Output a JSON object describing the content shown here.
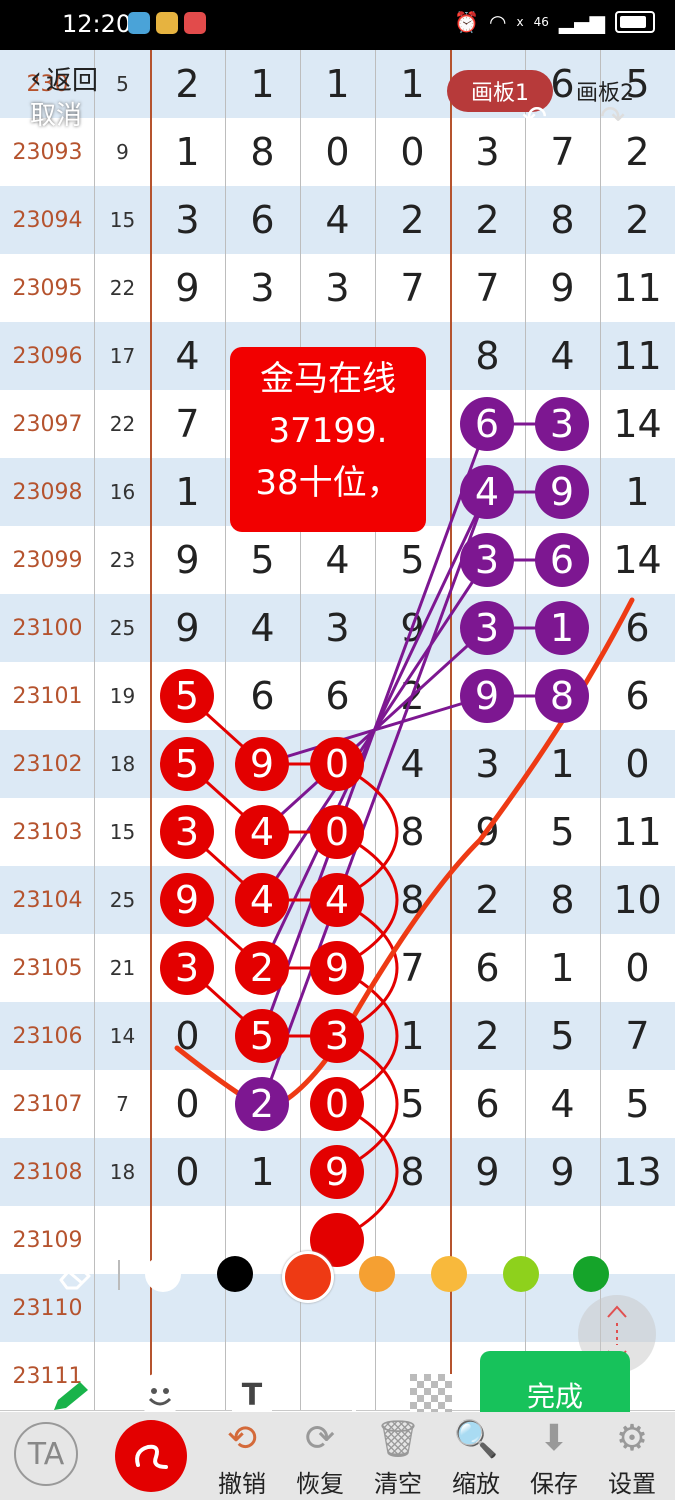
{
  "status": {
    "time": "12:20",
    "network": "46",
    "wifi_badge": "x"
  },
  "nav": {
    "back_label": "返回",
    "cancel_label": "取消",
    "board1_label": "画板1",
    "board2_label": "画板2"
  },
  "rows": [
    {
      "issue": "230",
      "sum": "5",
      "digits": [
        "2",
        "1",
        "1",
        "1",
        "",
        "6",
        "5"
      ]
    },
    {
      "issue": "23093",
      "sum": "9",
      "digits": [
        "1",
        "8",
        "0",
        "0",
        "3",
        "7",
        "2"
      ]
    },
    {
      "issue": "23094",
      "sum": "15",
      "digits": [
        "3",
        "6",
        "4",
        "2",
        "2",
        "8",
        "2"
      ]
    },
    {
      "issue": "23095",
      "sum": "22",
      "digits": [
        "9",
        "3",
        "3",
        "7",
        "7",
        "9",
        "11"
      ]
    },
    {
      "issue": "23096",
      "sum": "17",
      "digits": [
        "4",
        "",
        "",
        "",
        "8",
        "4",
        "11"
      ]
    },
    {
      "issue": "23097",
      "sum": "22",
      "digits": [
        "7",
        "",
        "",
        "",
        "",
        "",
        "14"
      ]
    },
    {
      "issue": "23098",
      "sum": "16",
      "digits": [
        "1",
        "",
        "",
        "",
        "",
        "",
        "1"
      ]
    },
    {
      "issue": "23099",
      "sum": "23",
      "digits": [
        "9",
        "5",
        "4",
        "5",
        "",
        "",
        "14"
      ]
    },
    {
      "issue": "23100",
      "sum": "25",
      "digits": [
        "9",
        "4",
        "3",
        "9",
        "",
        "",
        "6"
      ]
    },
    {
      "issue": "23101",
      "sum": "19",
      "digits": [
        "",
        "6",
        "6",
        "2",
        "",
        "",
        "6"
      ]
    },
    {
      "issue": "23102",
      "sum": "18",
      "digits": [
        "",
        "",
        "",
        "4",
        "3",
        "1",
        "0"
      ]
    },
    {
      "issue": "23103",
      "sum": "15",
      "digits": [
        "",
        "",
        "",
        "8",
        "9",
        "5",
        "11"
      ]
    },
    {
      "issue": "23104",
      "sum": "25",
      "digits": [
        "",
        "",
        "",
        "8",
        "2",
        "8",
        "10"
      ]
    },
    {
      "issue": "23105",
      "sum": "21",
      "digits": [
        "",
        "",
        "",
        "7",
        "6",
        "1",
        "0"
      ]
    },
    {
      "issue": "23106",
      "sum": "14",
      "digits": [
        "0",
        "",
        "",
        "1",
        "2",
        "5",
        "7"
      ]
    },
    {
      "issue": "23107",
      "sum": "7",
      "digits": [
        "0",
        "",
        "",
        "5",
        "6",
        "4",
        "5"
      ]
    },
    {
      "issue": "23108",
      "sum": "18",
      "digits": [
        "0",
        "1",
        "",
        "8",
        "9",
        "9",
        "13"
      ]
    },
    {
      "issue": "23109",
      "sum": "",
      "digits": [
        "",
        "",
        "",
        "",
        "",
        "",
        ""
      ]
    },
    {
      "issue": "23110",
      "sum": "",
      "digits": [
        "",
        "",
        "",
        "",
        "",
        "",
        ""
      ]
    },
    {
      "issue": "23111",
      "sum": "",
      "digits": [
        "",
        "",
        "",
        "",
        "",
        "",
        ""
      ]
    }
  ],
  "note": {
    "line1": "金马在线",
    "line2": "37199.",
    "line3": "38十位，"
  },
  "red_circles": [
    {
      "row": 9,
      "col": 0,
      "n": "5"
    },
    {
      "row": 10,
      "col": 0,
      "n": "5"
    },
    {
      "row": 10,
      "col": 1,
      "n": "9"
    },
    {
      "row": 10,
      "col": 2,
      "n": "0"
    },
    {
      "row": 11,
      "col": 0,
      "n": "3"
    },
    {
      "row": 11,
      "col": 1,
      "n": "4"
    },
    {
      "row": 11,
      "col": 2,
      "n": "0"
    },
    {
      "row": 12,
      "col": 0,
      "n": "9"
    },
    {
      "row": 12,
      "col": 1,
      "n": "4"
    },
    {
      "row": 12,
      "col": 2,
      "n": "4"
    },
    {
      "row": 13,
      "col": 0,
      "n": "3"
    },
    {
      "row": 13,
      "col": 1,
      "n": "2"
    },
    {
      "row": 13,
      "col": 2,
      "n": "9"
    },
    {
      "row": 14,
      "col": 1,
      "n": "5"
    },
    {
      "row": 14,
      "col": 2,
      "n": "3"
    },
    {
      "row": 15,
      "col": 2,
      "n": "0"
    },
    {
      "row": 16,
      "col": 2,
      "n": "9"
    },
    {
      "row": 17,
      "col": 2,
      "n": ""
    }
  ],
  "purple_circles": [
    {
      "row": 5,
      "col": 4,
      "n": "6"
    },
    {
      "row": 5,
      "col": 5,
      "n": "3"
    },
    {
      "row": 6,
      "col": 4,
      "n": "4"
    },
    {
      "row": 6,
      "col": 5,
      "n": "9"
    },
    {
      "row": 7,
      "col": 4,
      "n": "3"
    },
    {
      "row": 7,
      "col": 5,
      "n": "6"
    },
    {
      "row": 8,
      "col": 4,
      "n": "3"
    },
    {
      "row": 8,
      "col": 5,
      "n": "1"
    },
    {
      "row": 9,
      "col": 4,
      "n": "9"
    },
    {
      "row": 9,
      "col": 5,
      "n": "8"
    },
    {
      "row": 15,
      "col": 1,
      "n": "2"
    }
  ],
  "palette": {
    "colors": [
      "#ffffff",
      "#000000",
      "#ee3a14",
      "#f5a032",
      "#f8b93c",
      "#8ed11c",
      "#15a42a"
    ],
    "selected_index": 2
  },
  "tools": {
    "done_label": "完成"
  },
  "bottom": {
    "undo": "撤销",
    "redo": "恢复",
    "clear": "清空",
    "zoom": "缩放",
    "save": "保存",
    "settings": "设置",
    "text_style": "TA"
  }
}
